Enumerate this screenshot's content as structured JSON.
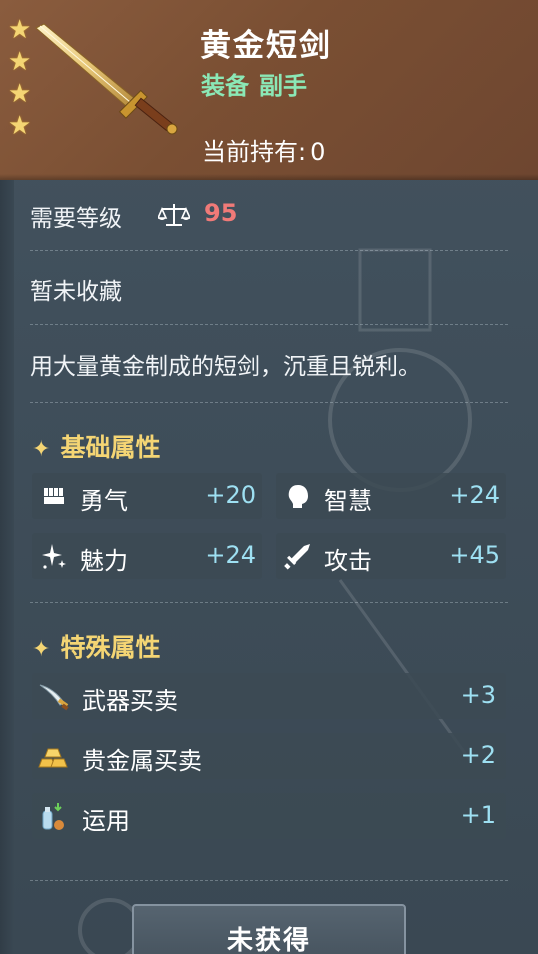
{
  "item": {
    "name": "黄金短剑",
    "type_main": "装备",
    "type_sub": "副手",
    "holding_label": "当前持有:",
    "holding_value": "0",
    "stars": 4
  },
  "requirement": {
    "level_label": "需要等级",
    "level_icon": "scale-icon",
    "level_value": "95"
  },
  "collection_status": "暂未收藏",
  "description": "用大量黄金制成的短剑，沉重且锐利。",
  "basic_section": {
    "title": "基础属性",
    "stats": [
      {
        "icon": "fist-icon",
        "label": "勇气",
        "value": "+20"
      },
      {
        "icon": "head-icon",
        "label": "智慧",
        "value": "+24"
      },
      {
        "icon": "sparkle-icon",
        "label": "魅力",
        "value": "+24"
      },
      {
        "icon": "sword-icon",
        "label": "攻击",
        "value": "+45"
      }
    ]
  },
  "special_section": {
    "title": "特殊属性",
    "stats": [
      {
        "icon": "scimitar-icon",
        "label": "武器买卖",
        "value": "+3"
      },
      {
        "icon": "gold-bars-icon",
        "label": "贵金属买卖",
        "value": "+2"
      },
      {
        "icon": "potion-icon",
        "label": "运用",
        "value": "+1"
      }
    ]
  },
  "action_button": "未获得",
  "colors": {
    "header_brown": "#7a4f33",
    "star_gold": "#f4d574",
    "type_green": "#8be8b6",
    "level_red": "#f07a78",
    "value_cyan": "#9ee0f2",
    "section_gold": "#f4d574"
  }
}
